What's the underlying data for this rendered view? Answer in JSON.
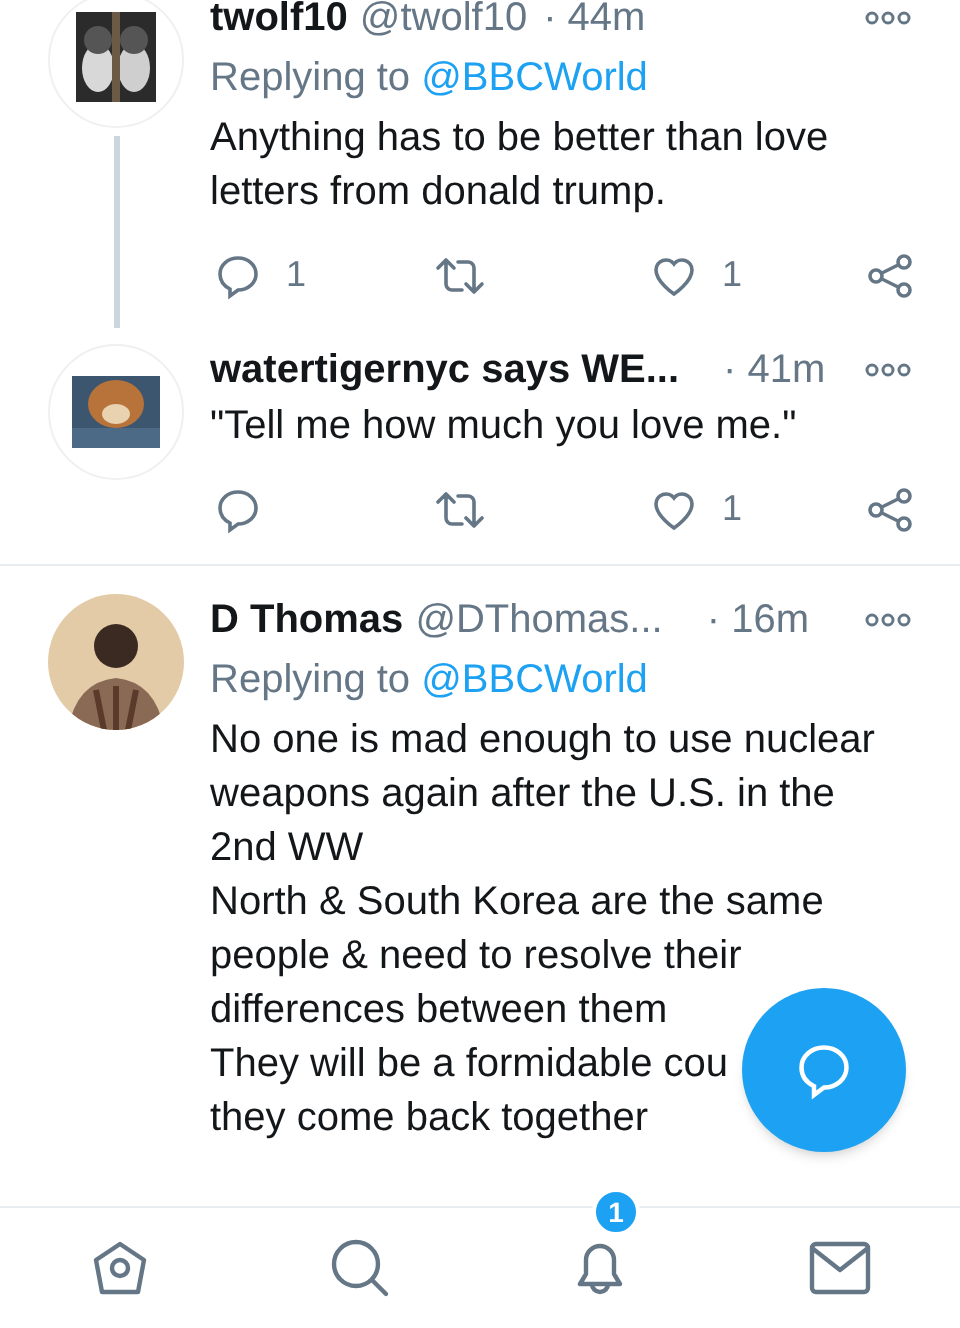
{
  "tweets": [
    {
      "name": "twolf10",
      "handle": "@twolf10",
      "time": "· 44m",
      "replying_label": "Replying to",
      "replying_handle": "@BBCWorld",
      "body_lines": [
        "Anything has to be better than love",
        "letters from donald trump."
      ],
      "reply_count": "1",
      "like_count": "1",
      "thread_line": true
    },
    {
      "name": "watertigernyc says WE...",
      "time": "· 41m",
      "body_lines": [
        "\"Tell me how much you love me.\""
      ],
      "like_count": "1",
      "thread_line": false
    },
    {
      "name": "D Thomas",
      "handle": "@DThomas...",
      "time": "· 16m",
      "replying_label": "Replying to",
      "replying_handle": "@BBCWorld",
      "body_lines": [
        "No one is mad enough to use nuclear",
        "weapons again after the U.S. in the",
        "2nd WW",
        "North & South Korea are the same",
        "people & need to resolve their",
        "differences between them",
        "They will be a formidable cou",
        "they come back together"
      ],
      "thread_line": false
    }
  ],
  "notification_badge": "1"
}
